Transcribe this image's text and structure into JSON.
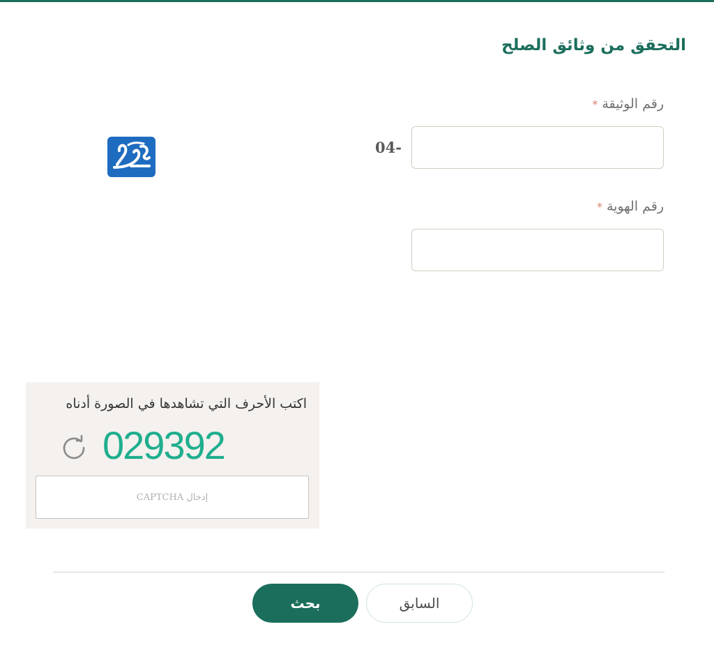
{
  "page": {
    "title": "التحقق من وثائق الصلح"
  },
  "form": {
    "document_number": {
      "label": "رقم الوثيقة",
      "required_mark": "*",
      "prefix": "04-",
      "value": ""
    },
    "id_number": {
      "label": "رقم الهوية",
      "required_mark": "*",
      "value": ""
    }
  },
  "captcha": {
    "instruction": "اكتب الأحرف التي تشاهدها في الصورة أدناه",
    "code": "029392",
    "input_placeholder": "إدخال CAPTCHA",
    "code_color": "#1fae8e"
  },
  "actions": {
    "search_label": "بحث",
    "previous_label": "السابق"
  },
  "icons": {
    "refresh": "refresh-icon",
    "logo": "site-logo"
  },
  "colors": {
    "primary": "#1b6e5c",
    "required": "#d9826e",
    "captcha_panel": "#f4f1ee",
    "logo_background": "#1e6cc0"
  }
}
